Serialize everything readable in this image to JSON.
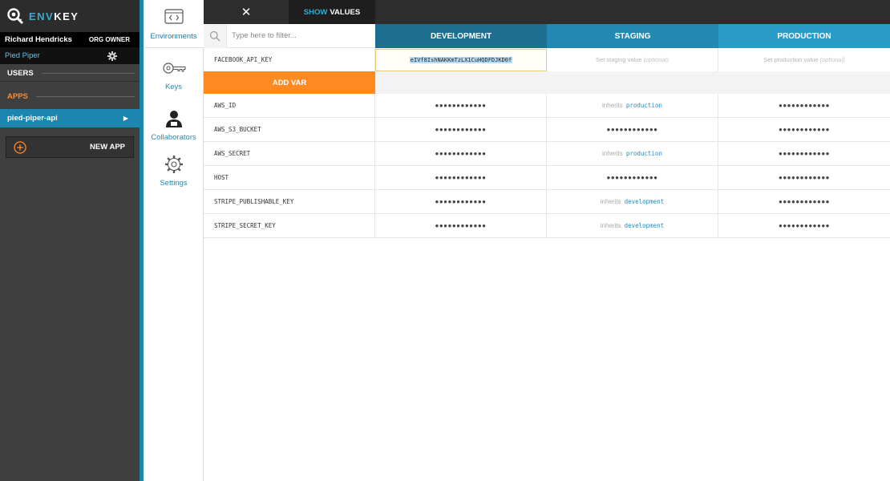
{
  "app": {
    "logo_prefix": "ENV",
    "logo_suffix": "KEY"
  },
  "user": {
    "name": "Richard Hendricks",
    "role": "ORG OWNER"
  },
  "org": {
    "name": "Pied Piper"
  },
  "sidebar": {
    "users_label": "USERS",
    "apps_label": "APPS",
    "selected_app": "pied-piper-api",
    "new_app_label": "NEW APP"
  },
  "subnav": [
    {
      "label": "Environments",
      "icon": "code-window-icon",
      "active": true
    },
    {
      "label": "Keys",
      "icon": "key-icon",
      "active": false
    },
    {
      "label": "Collaborators",
      "icon": "person-icon",
      "active": false
    },
    {
      "label": "Settings",
      "icon": "gear-icon",
      "active": false
    }
  ],
  "toolbar": {
    "close_glyph": "✕",
    "show_prefix": "SHOW",
    "show_suffix": "VALUES"
  },
  "filter": {
    "placeholder": "Type here to filter..."
  },
  "environments": [
    "DEVELOPMENT",
    "STAGING",
    "PRODUCTION"
  ],
  "new_var": {
    "name": "FACEBOOK_API_KEY",
    "development_value": "eIVf8IshNAKKmTzLX1CuHQDFDJKD0f",
    "staging_placeholder": "Set staging value",
    "production_placeholder": "Set production value",
    "optional_label": "(optional)",
    "add_label": "ADD VAR"
  },
  "inherits_label": "inherits",
  "masked": "●●●●●●●●●●●●",
  "vars": [
    {
      "name": "AWS_ID",
      "staging_inherits": "production"
    },
    {
      "name": "AWS_S3_BUCKET",
      "staging_inherits": null
    },
    {
      "name": "AWS_SECRET",
      "staging_inherits": "production"
    },
    {
      "name": "HOST",
      "staging_inherits": null
    },
    {
      "name": "STRIPE_PUBLISHABLE_KEY",
      "staging_inherits": "development"
    },
    {
      "name": "STRIPE_SECRET_KEY",
      "staging_inherits": "development"
    }
  ],
  "colors": {
    "accent_blue": "#1d86b0",
    "accent_orange": "#ff8a22",
    "sidebar_bg": "#3f3f3f"
  }
}
